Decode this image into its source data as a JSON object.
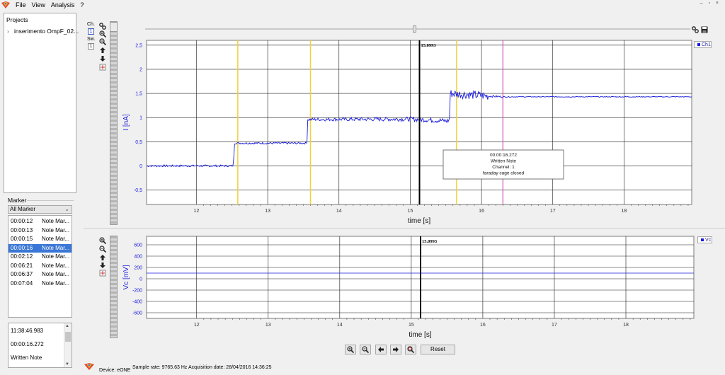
{
  "menubar": {
    "items": [
      "File",
      "View",
      "Analysis",
      "?"
    ],
    "window_controls": "– ▫ ×"
  },
  "projects": {
    "title": "Projects",
    "items": [
      {
        "label": "inserimento OmpF_02..."
      }
    ]
  },
  "marker": {
    "label": "Marker",
    "filter": "All Marker",
    "rows": [
      {
        "time": "00:00:12",
        "name": "Note Mar..."
      },
      {
        "time": "00:00:13",
        "name": "Note Mar..."
      },
      {
        "time": "00:00:15",
        "name": "Note Mar..."
      },
      {
        "time": "00:00:16",
        "name": "Note Mar..."
      },
      {
        "time": "00:02:12",
        "name": "Note Mar..."
      },
      {
        "time": "00:06:21",
        "name": "Note Mar..."
      },
      {
        "time": "00:06:37",
        "name": "Note Mar..."
      },
      {
        "time": "00:07:04",
        "name": "Note Mar..."
      }
    ],
    "selected_index": 3
  },
  "note": {
    "lines": [
      "11:38:46.983",
      "00:00:16.272",
      "Written Note"
    ]
  },
  "toolbar_top": {
    "ch_label": "Ch.",
    "ch_value": "1",
    "sw_label": "Sw.",
    "sw_value": "1"
  },
  "bottom_controls": {
    "reset_label": "Reset"
  },
  "status": {
    "device": "Device: eONE",
    "info": "Sample rate: 9765.63 Hz  Acquisition date: 28/04/2016 14:36:25"
  },
  "colors": {
    "trace": "#1a1add",
    "marker_yellow": "#f0d23a",
    "marker_pink": "#d65ab8",
    "cursor": "#000000",
    "selection": "#3a77d6"
  },
  "chart_data": [
    {
      "type": "line",
      "ylabel": "I [nA]",
      "xlabel": "time [s]",
      "xlim": [
        11.3,
        18.95
      ],
      "ylim": [
        -0.8,
        2.6
      ],
      "x_ticks": [
        "12",
        "13",
        "14",
        "15",
        "16",
        "17",
        "18"
      ],
      "y_ticks": [
        "-0,5",
        "0",
        "0,5",
        "1",
        "1,5",
        "2",
        "2,5"
      ],
      "y_tick_values": [
        -0.5,
        0,
        0.5,
        1,
        1.5,
        2,
        2.5
      ],
      "series": [
        {
          "name": "Ch1",
          "x": [
            11.3,
            12.52,
            12.53,
            13.55,
            13.56,
            15.0,
            15.55,
            15.56,
            16.05,
            16.3,
            18.95
          ],
          "y": [
            0.0,
            0.0,
            0.47,
            0.47,
            0.96,
            0.97,
            0.93,
            1.5,
            1.45,
            1.43,
            1.43
          ]
        }
      ],
      "yellow_markers": [
        12.58,
        13.6,
        15.65
      ],
      "pink_marker": 16.3,
      "cursor": {
        "x": 15.13,
        "label": "15.0993"
      },
      "annotation": {
        "lines": [
          "00:00:16.272",
          "Written Note",
          "Channel: 1",
          "faraday cage closed"
        ]
      }
    },
    {
      "type": "line",
      "ylabel": "Vc [mV]",
      "xlabel": "time [s]",
      "xlim": [
        11.3,
        18.95
      ],
      "ylim": [
        -700,
        750
      ],
      "x_ticks": [
        "12",
        "13",
        "14",
        "15",
        "16",
        "17",
        "18"
      ],
      "y_ticks": [
        "-600",
        "-400",
        "-200",
        "0",
        "200",
        "400",
        "600"
      ],
      "y_tick_values": [
        -600,
        -400,
        -200,
        0,
        200,
        400,
        600
      ],
      "series": [
        {
          "name": "Vc",
          "x": [
            11.3,
            18.95
          ],
          "y": [
            100,
            100
          ]
        }
      ],
      "cursor": {
        "x": 15.13,
        "label": "15.0993"
      }
    }
  ]
}
